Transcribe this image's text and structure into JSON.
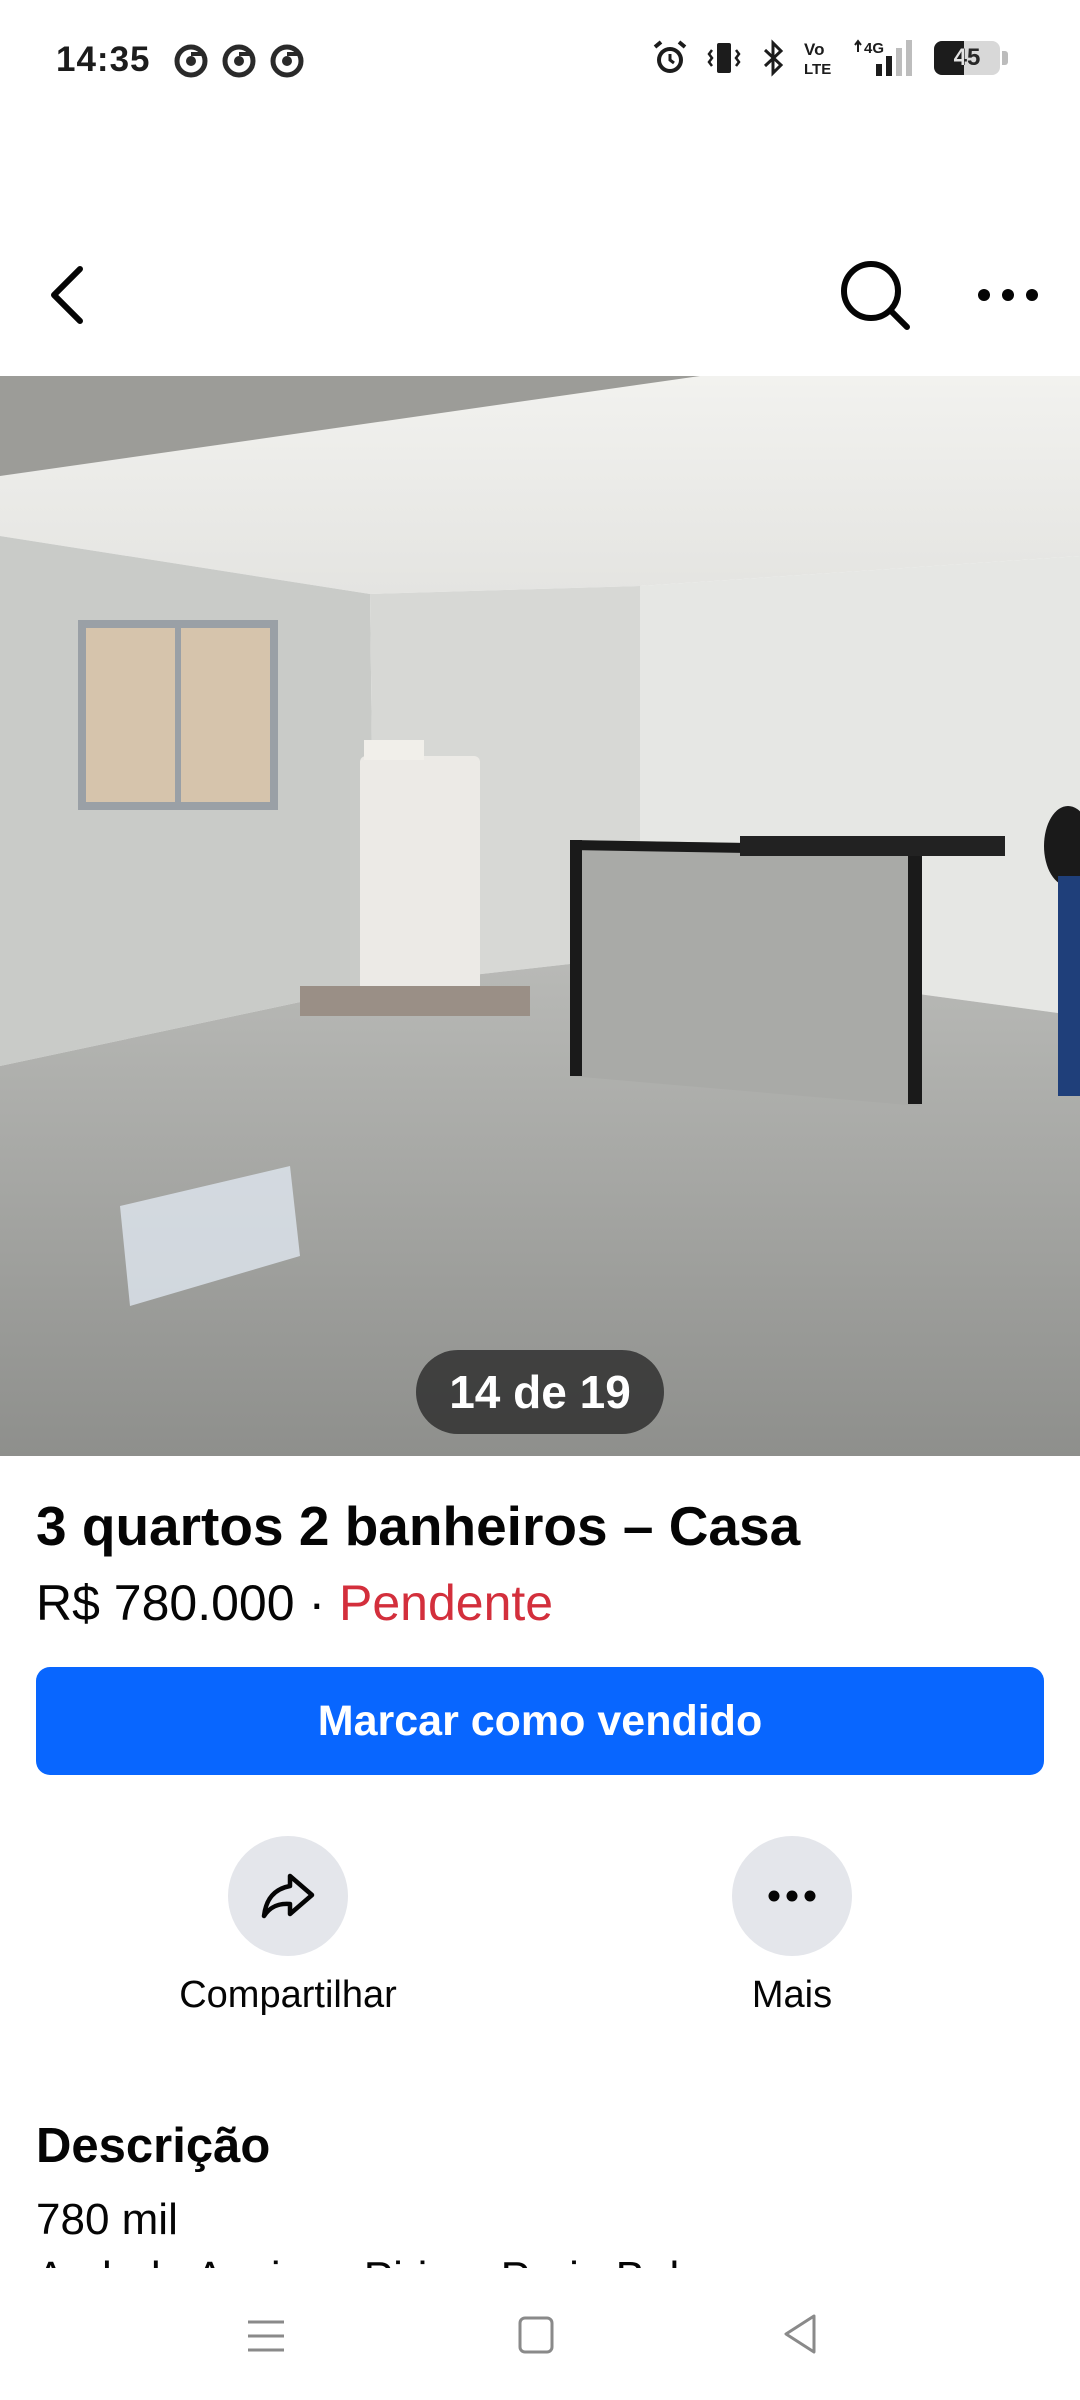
{
  "status_bar": {
    "time": "14:35",
    "left_icons": [
      "chrome-icon",
      "chrome-icon",
      "chrome-icon"
    ],
    "right_icons": [
      "alarm-icon",
      "vibrate-icon",
      "bluetooth-icon",
      "volte-icon",
      "signal-4g-icon"
    ],
    "volte_label": "Vo\nLTE",
    "network_label": "4G",
    "battery_level": "45"
  },
  "top_nav": {
    "back_icon": "chevron-left-icon",
    "search_icon": "search-icon",
    "more_icon": "more-horizontal-icon"
  },
  "photo": {
    "counter": "14 de 19"
  },
  "listing": {
    "title": "3 quartos 2 banheiros – Casa",
    "price": "R$ 780.000",
    "separator": " · ",
    "status": "Pendente",
    "status_color": "#d32f3c"
  },
  "primary_action": {
    "label": "Marcar como vendido",
    "color": "#0866ff"
  },
  "actions": [
    {
      "label": "Compartilhar",
      "icon": "share-icon"
    },
    {
      "label": "Mais",
      "icon": "more-horizontal-icon"
    }
  ],
  "description": {
    "heading": "Descrição",
    "line1": "780 mil",
    "line2": "Ao lado Acaiaca Piriras Praia Bela"
  },
  "system_nav": {
    "icons": [
      "menu-icon",
      "home-icon",
      "back-icon"
    ]
  }
}
